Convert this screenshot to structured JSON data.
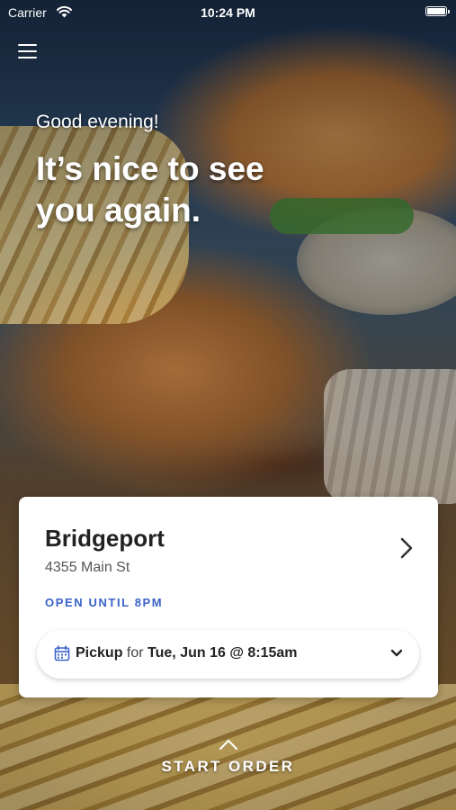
{
  "status_bar": {
    "carrier": "Carrier",
    "time": "10:24 PM"
  },
  "header": {
    "greeting": "Good evening!",
    "headline": "It’s nice to see you again."
  },
  "location_card": {
    "name": "Bridgeport",
    "address": "4355 Main St",
    "hours": "OPEN UNTIL 8PM",
    "pickup": {
      "mode": "Pickup",
      "connector": "for",
      "datetime": "Tue, Jun 16 @ 8:15am"
    }
  },
  "footer": {
    "start_order": "START ORDER"
  },
  "colors": {
    "accent": "#3a63c9",
    "text_dark": "#222222"
  },
  "icons": [
    "wifi-icon",
    "battery-icon",
    "menu-icon",
    "chevron-right-icon",
    "calendar-icon",
    "chevron-down-icon",
    "chevron-up-icon"
  ]
}
